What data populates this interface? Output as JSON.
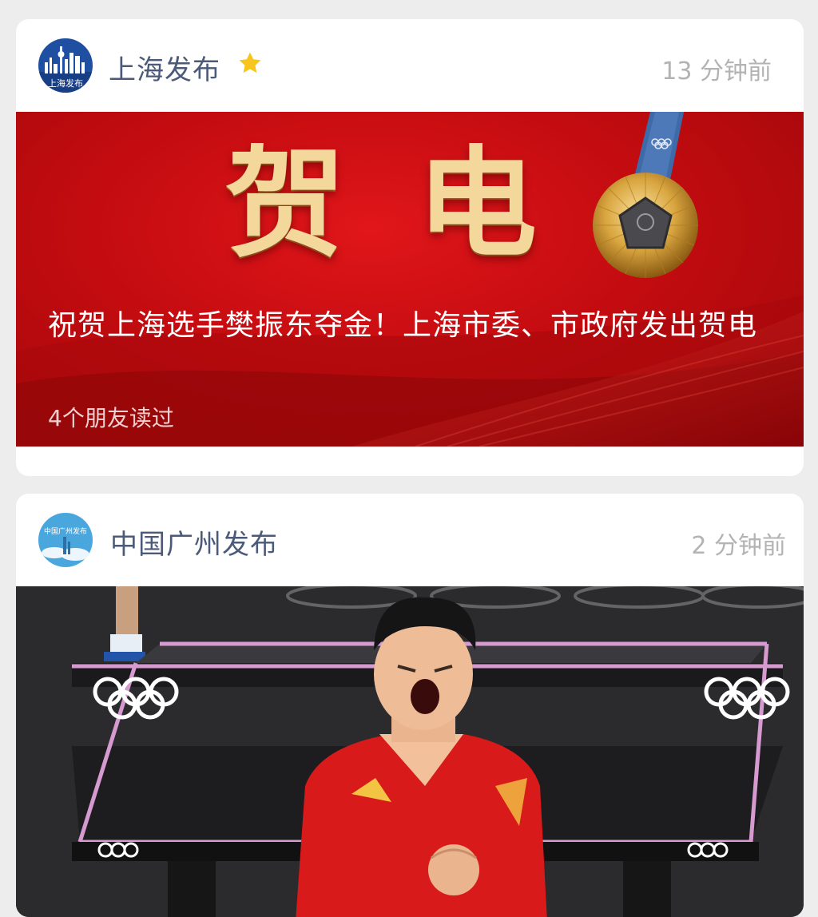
{
  "feed": [
    {
      "account_name": "上海发布",
      "starred": true,
      "time": "13 分钟前",
      "avatar_text": "上海发布",
      "banner_title": "贺电",
      "headline": "祝贺上海选手樊振东夺金！上海市委、市政府发出贺电",
      "read_count": "4个朋友读过"
    },
    {
      "account_name": "中国广州发布",
      "starred": false,
      "time": "2 分钟前",
      "avatar_text": "中国广州发布"
    }
  ],
  "colors": {
    "banner_red": "#c40c10",
    "title_gold": "#f3d79b",
    "account_name": "#4a5a78",
    "timestamp": "#b3b3b3",
    "star": "#f7c51e"
  }
}
